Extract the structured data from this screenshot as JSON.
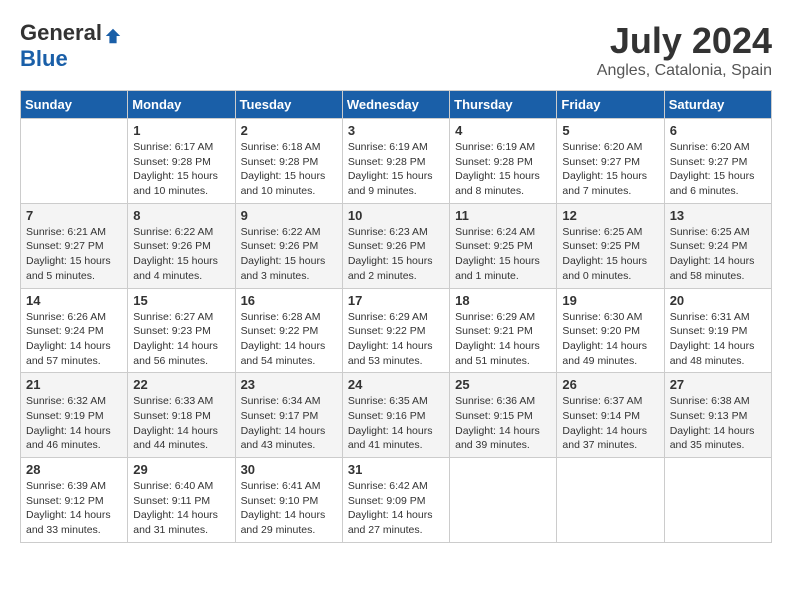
{
  "logo": {
    "general": "General",
    "blue": "Blue"
  },
  "title": {
    "month_year": "July 2024",
    "location": "Angles, Catalonia, Spain"
  },
  "weekdays": [
    "Sunday",
    "Monday",
    "Tuesday",
    "Wednesday",
    "Thursday",
    "Friday",
    "Saturday"
  ],
  "weeks": [
    [
      {
        "day": "",
        "sunrise": "",
        "sunset": "",
        "daylight": ""
      },
      {
        "day": "1",
        "sunrise": "Sunrise: 6:17 AM",
        "sunset": "Sunset: 9:28 PM",
        "daylight": "Daylight: 15 hours and 10 minutes."
      },
      {
        "day": "2",
        "sunrise": "Sunrise: 6:18 AM",
        "sunset": "Sunset: 9:28 PM",
        "daylight": "Daylight: 15 hours and 10 minutes."
      },
      {
        "day": "3",
        "sunrise": "Sunrise: 6:19 AM",
        "sunset": "Sunset: 9:28 PM",
        "daylight": "Daylight: 15 hours and 9 minutes."
      },
      {
        "day": "4",
        "sunrise": "Sunrise: 6:19 AM",
        "sunset": "Sunset: 9:28 PM",
        "daylight": "Daylight: 15 hours and 8 minutes."
      },
      {
        "day": "5",
        "sunrise": "Sunrise: 6:20 AM",
        "sunset": "Sunset: 9:27 PM",
        "daylight": "Daylight: 15 hours and 7 minutes."
      },
      {
        "day": "6",
        "sunrise": "Sunrise: 6:20 AM",
        "sunset": "Sunset: 9:27 PM",
        "daylight": "Daylight: 15 hours and 6 minutes."
      }
    ],
    [
      {
        "day": "7",
        "sunrise": "Sunrise: 6:21 AM",
        "sunset": "Sunset: 9:27 PM",
        "daylight": "Daylight: 15 hours and 5 minutes."
      },
      {
        "day": "8",
        "sunrise": "Sunrise: 6:22 AM",
        "sunset": "Sunset: 9:26 PM",
        "daylight": "Daylight: 15 hours and 4 minutes."
      },
      {
        "day": "9",
        "sunrise": "Sunrise: 6:22 AM",
        "sunset": "Sunset: 9:26 PM",
        "daylight": "Daylight: 15 hours and 3 minutes."
      },
      {
        "day": "10",
        "sunrise": "Sunrise: 6:23 AM",
        "sunset": "Sunset: 9:26 PM",
        "daylight": "Daylight: 15 hours and 2 minutes."
      },
      {
        "day": "11",
        "sunrise": "Sunrise: 6:24 AM",
        "sunset": "Sunset: 9:25 PM",
        "daylight": "Daylight: 15 hours and 1 minute."
      },
      {
        "day": "12",
        "sunrise": "Sunrise: 6:25 AM",
        "sunset": "Sunset: 9:25 PM",
        "daylight": "Daylight: 15 hours and 0 minutes."
      },
      {
        "day": "13",
        "sunrise": "Sunrise: 6:25 AM",
        "sunset": "Sunset: 9:24 PM",
        "daylight": "Daylight: 14 hours and 58 minutes."
      }
    ],
    [
      {
        "day": "14",
        "sunrise": "Sunrise: 6:26 AM",
        "sunset": "Sunset: 9:24 PM",
        "daylight": "Daylight: 14 hours and 57 minutes."
      },
      {
        "day": "15",
        "sunrise": "Sunrise: 6:27 AM",
        "sunset": "Sunset: 9:23 PM",
        "daylight": "Daylight: 14 hours and 56 minutes."
      },
      {
        "day": "16",
        "sunrise": "Sunrise: 6:28 AM",
        "sunset": "Sunset: 9:22 PM",
        "daylight": "Daylight: 14 hours and 54 minutes."
      },
      {
        "day": "17",
        "sunrise": "Sunrise: 6:29 AM",
        "sunset": "Sunset: 9:22 PM",
        "daylight": "Daylight: 14 hours and 53 minutes."
      },
      {
        "day": "18",
        "sunrise": "Sunrise: 6:29 AM",
        "sunset": "Sunset: 9:21 PM",
        "daylight": "Daylight: 14 hours and 51 minutes."
      },
      {
        "day": "19",
        "sunrise": "Sunrise: 6:30 AM",
        "sunset": "Sunset: 9:20 PM",
        "daylight": "Daylight: 14 hours and 49 minutes."
      },
      {
        "day": "20",
        "sunrise": "Sunrise: 6:31 AM",
        "sunset": "Sunset: 9:19 PM",
        "daylight": "Daylight: 14 hours and 48 minutes."
      }
    ],
    [
      {
        "day": "21",
        "sunrise": "Sunrise: 6:32 AM",
        "sunset": "Sunset: 9:19 PM",
        "daylight": "Daylight: 14 hours and 46 minutes."
      },
      {
        "day": "22",
        "sunrise": "Sunrise: 6:33 AM",
        "sunset": "Sunset: 9:18 PM",
        "daylight": "Daylight: 14 hours and 44 minutes."
      },
      {
        "day": "23",
        "sunrise": "Sunrise: 6:34 AM",
        "sunset": "Sunset: 9:17 PM",
        "daylight": "Daylight: 14 hours and 43 minutes."
      },
      {
        "day": "24",
        "sunrise": "Sunrise: 6:35 AM",
        "sunset": "Sunset: 9:16 PM",
        "daylight": "Daylight: 14 hours and 41 minutes."
      },
      {
        "day": "25",
        "sunrise": "Sunrise: 6:36 AM",
        "sunset": "Sunset: 9:15 PM",
        "daylight": "Daylight: 14 hours and 39 minutes."
      },
      {
        "day": "26",
        "sunrise": "Sunrise: 6:37 AM",
        "sunset": "Sunset: 9:14 PM",
        "daylight": "Daylight: 14 hours and 37 minutes."
      },
      {
        "day": "27",
        "sunrise": "Sunrise: 6:38 AM",
        "sunset": "Sunset: 9:13 PM",
        "daylight": "Daylight: 14 hours and 35 minutes."
      }
    ],
    [
      {
        "day": "28",
        "sunrise": "Sunrise: 6:39 AM",
        "sunset": "Sunset: 9:12 PM",
        "daylight": "Daylight: 14 hours and 33 minutes."
      },
      {
        "day": "29",
        "sunrise": "Sunrise: 6:40 AM",
        "sunset": "Sunset: 9:11 PM",
        "daylight": "Daylight: 14 hours and 31 minutes."
      },
      {
        "day": "30",
        "sunrise": "Sunrise: 6:41 AM",
        "sunset": "Sunset: 9:10 PM",
        "daylight": "Daylight: 14 hours and 29 minutes."
      },
      {
        "day": "31",
        "sunrise": "Sunrise: 6:42 AM",
        "sunset": "Sunset: 9:09 PM",
        "daylight": "Daylight: 14 hours and 27 minutes."
      },
      {
        "day": "",
        "sunrise": "",
        "sunset": "",
        "daylight": ""
      },
      {
        "day": "",
        "sunrise": "",
        "sunset": "",
        "daylight": ""
      },
      {
        "day": "",
        "sunrise": "",
        "sunset": "",
        "daylight": ""
      }
    ]
  ]
}
